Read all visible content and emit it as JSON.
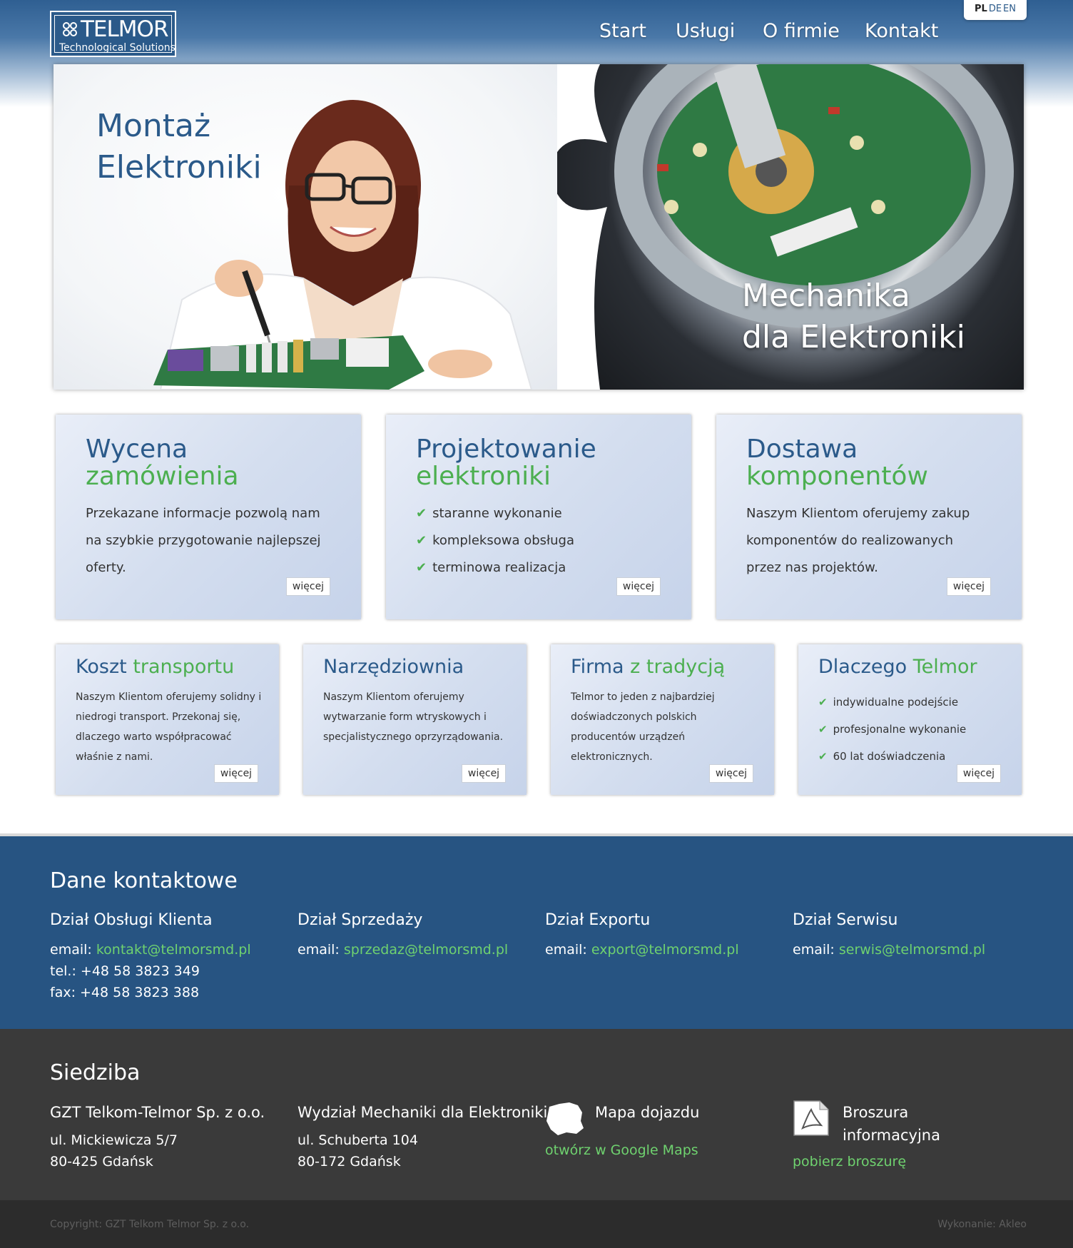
{
  "header": {
    "logo_name": "TELMOR",
    "logo_sub": "Technological Solutions",
    "nav": [
      "Start",
      "Usługi",
      "O firmie",
      "Kontakt"
    ],
    "languages": [
      "PL",
      "DE",
      "EN"
    ],
    "active_language": "PL"
  },
  "hero": {
    "left_title_1": "Montaż",
    "left_title_2": "Elektroniki",
    "right_title_1": "Mechanika",
    "right_title_2": "dla Elektroniki"
  },
  "cards_large": [
    {
      "title1": "Wycena",
      "title2": "zamówienia",
      "text": "Przekazane informacje pozwolą nam na szybkie przygotowanie najlepszej oferty.",
      "more": "więcej"
    },
    {
      "title1": "Projektowanie",
      "title2": "elektroniki",
      "items": [
        "staranne wykonanie",
        "kompleksowa obsługa",
        "terminowa realizacja"
      ],
      "more": "więcej"
    },
    {
      "title1": "Dostawa",
      "title2": "komponentów",
      "text": "Naszym Klientom oferujemy zakup komponentów do realizowanych przez nas projektów.",
      "more": "więcej"
    }
  ],
  "cards_small": [
    {
      "title1": "Koszt",
      "title2": "transportu",
      "text": "Naszym Klientom oferujemy solidny i niedrogi transport. Przekonaj się, dlaczego warto współpracować właśnie z nami.",
      "more": "więcej"
    },
    {
      "title1": "Narzędziownia",
      "title2": "",
      "text": "Naszym Klientom oferujemy wytwarzanie form wtryskowych i specjalistycznego oprzyrządowania.",
      "more": "więcej"
    },
    {
      "title1": "Firma",
      "title2": "z tradycją",
      "text": "Telmor to jeden z najbardziej doświadczonych polskich producentów urządzeń elektronicznych.",
      "more": "więcej"
    },
    {
      "title1": "Dlaczego",
      "title2": "Telmor",
      "items": [
        "indywidualne podejście",
        "profesjonalne wykonanie",
        "60 lat doświadczenia"
      ],
      "more": "więcej"
    }
  ],
  "contact": {
    "title": "Dane kontaktowe",
    "columns": [
      {
        "heading": "Dział Obsługi Klienta",
        "email_label": "email:",
        "email": "kontakt@telmorsmd.pl",
        "tel": "tel.: +48 58 3823 349",
        "fax": "fax: +48 58 3823 388"
      },
      {
        "heading": "Dział Sprzedaży",
        "email_label": "email:",
        "email": "sprzedaz@telmorsmd.pl"
      },
      {
        "heading": "Dział Exportu",
        "email_label": "email:",
        "email": "export@telmorsmd.pl"
      },
      {
        "heading": "Dział Serwisu",
        "email_label": "email:",
        "email": "serwis@telmorsmd.pl"
      }
    ]
  },
  "siedziba": {
    "title": "Siedziba",
    "hq": {
      "name": "GZT Telkom-Telmor Sp. z o.o.",
      "street": "ul. Mickiewicza 5/7",
      "city": "80-425 Gdańsk"
    },
    "wydzial": {
      "name": "Wydział Mechaniki dla Elektroniki",
      "street": "ul. Schuberta 104",
      "city": "80-172 Gdańsk"
    },
    "map": {
      "title": "Mapa dojazdu",
      "link": "otwórz w Google Maps"
    },
    "brochure": {
      "title_1": "Broszura",
      "title_2": "informacyjna",
      "link": "pobierz broszurę"
    }
  },
  "footer": {
    "copyright": "Copyright: GZT Telkom Telmor Sp. z o.o.",
    "made_by": "Wykonanie: Akleo"
  }
}
